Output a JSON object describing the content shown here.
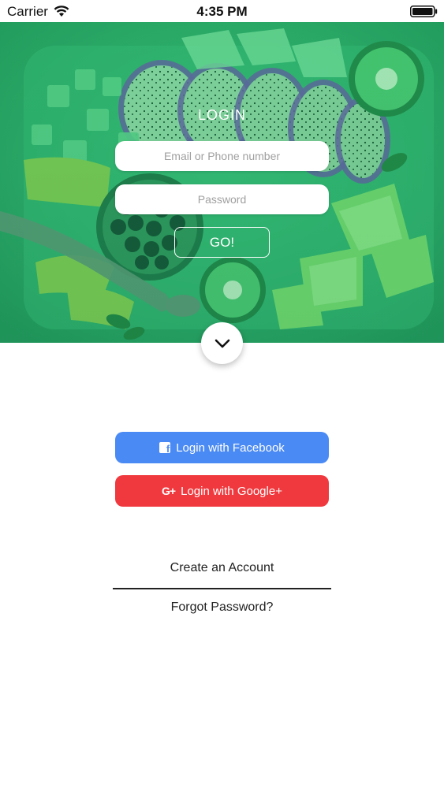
{
  "status_bar": {
    "carrier": "Carrier",
    "time": "4:35 PM",
    "icons": [
      "wifi-icon",
      "battery-icon"
    ]
  },
  "hero": {
    "title": "LOGIN",
    "background": "green-tinted fruit platter photo",
    "tint_color": "#2fa868"
  },
  "login_form": {
    "email_placeholder": "Email or Phone number",
    "password_placeholder": "Password",
    "go_label": "GO!"
  },
  "chevron": {
    "icon": "chevron-down-icon"
  },
  "social": {
    "facebook_label": "Login with Facebook",
    "facebook_color": "#4a8af4",
    "facebook_icon": "facebook-icon",
    "google_icon_text": "G+",
    "google_label": "Login with Google+",
    "google_color": "#f0393e",
    "google_icon": "google-plus-icon"
  },
  "links": {
    "create_account": "Create an Account",
    "forgot_password": "Forgot Password?"
  }
}
